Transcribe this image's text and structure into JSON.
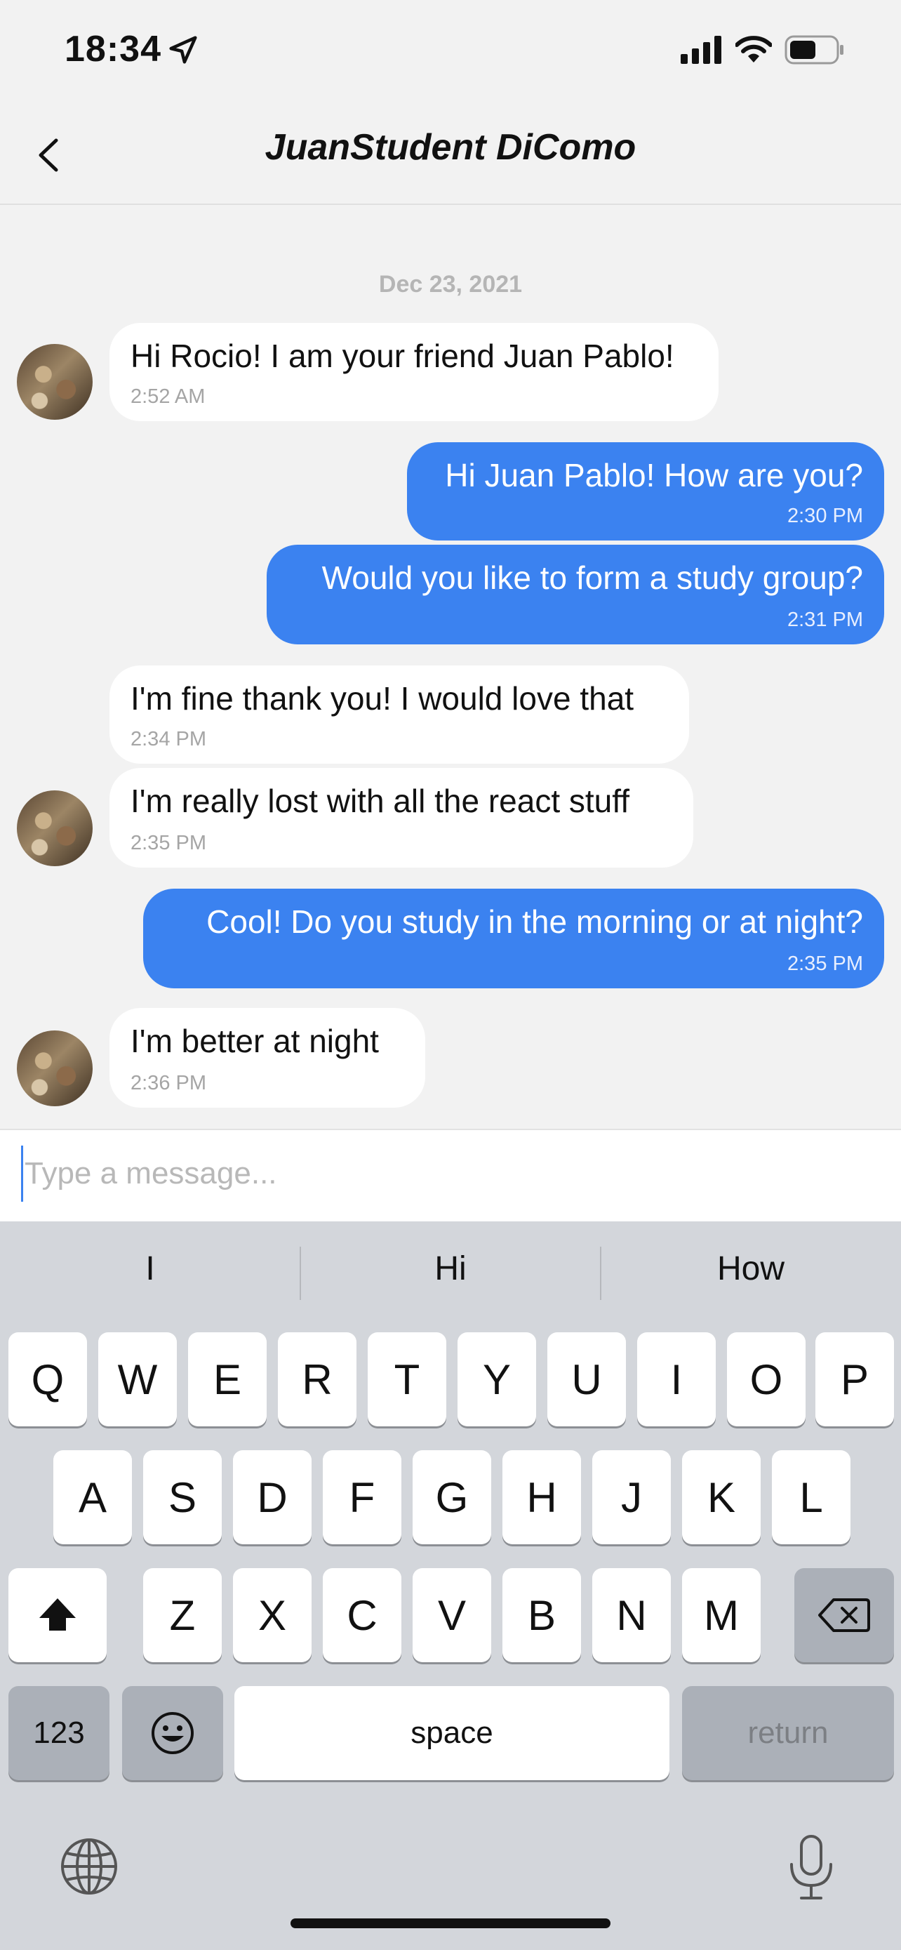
{
  "status_bar": {
    "time": "18:34",
    "icons": [
      "location-arrow-icon",
      "cellular-signal-icon",
      "wifi-icon",
      "battery-icon"
    ]
  },
  "header": {
    "title": "JuanStudent DiComo",
    "back_icon": "chevron-left-icon"
  },
  "chat": {
    "date": "Dec 23, 2021",
    "messages": [
      {
        "direction": "incoming",
        "text": "Hi Rocio! I am your friend Juan Pablo!",
        "time": "2:52 AM",
        "avatar": true
      },
      {
        "direction": "outgoing",
        "text": "Hi Juan Pablo! How are you?",
        "time": "2:30 PM"
      },
      {
        "direction": "outgoing",
        "text": "Would you like to form a study group?",
        "time": "2:31 PM"
      },
      {
        "direction": "incoming",
        "text": "I'm fine thank you! I would love that",
        "time": "2:34 PM",
        "avatar": false
      },
      {
        "direction": "incoming",
        "text": "I'm really lost with all the react stuff",
        "time": "2:35 PM",
        "avatar": true
      },
      {
        "direction": "outgoing",
        "text": "Cool! Do you study in the morning or at night?",
        "time": "2:35 PM"
      },
      {
        "direction": "incoming",
        "text": "I'm better at night",
        "time": "2:36 PM",
        "avatar": true
      }
    ]
  },
  "composer": {
    "placeholder": "Type a message..."
  },
  "keyboard": {
    "suggestions": [
      "I",
      "Hi",
      "How"
    ],
    "row1": [
      "Q",
      "W",
      "E",
      "R",
      "T",
      "Y",
      "U",
      "I",
      "O",
      "P"
    ],
    "row2": [
      "A",
      "S",
      "D",
      "F",
      "G",
      "H",
      "J",
      "K",
      "L"
    ],
    "row3": [
      "Z",
      "X",
      "C",
      "V",
      "B",
      "N",
      "M"
    ],
    "numbers_label": "123",
    "space_label": "space",
    "return_label": "return",
    "shift_icon": "shift-arrow-icon",
    "delete_icon": "delete-backspace-icon",
    "emoji_icon": "emoji-smiley-icon",
    "globe_icon": "globe-icon",
    "mic_icon": "microphone-icon"
  },
  "colors": {
    "outgoing_bubble": "#3b82f0",
    "incoming_bubble": "#ffffff",
    "background": "#f2f2f2",
    "keyboard_bg": "#d3d6db"
  }
}
